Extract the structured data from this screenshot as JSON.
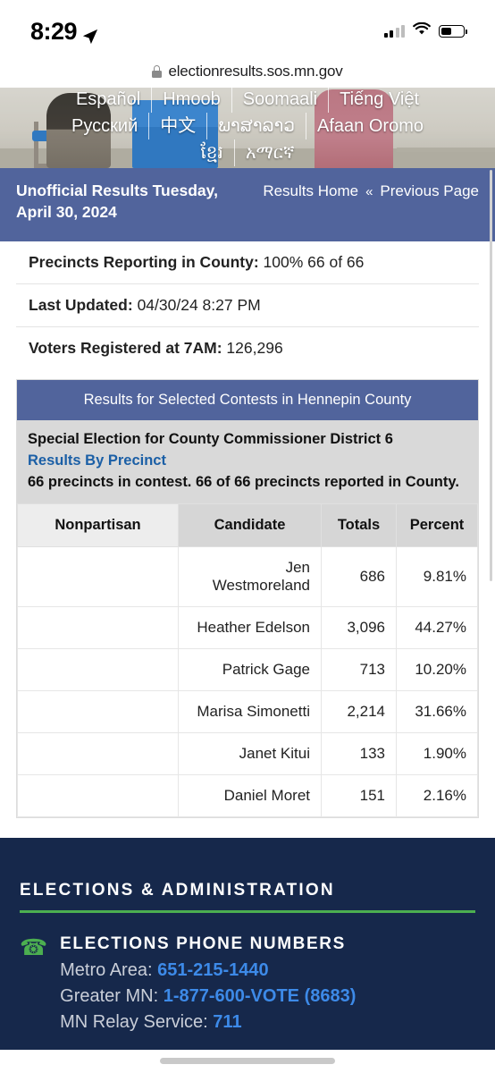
{
  "status_bar": {
    "time": "8:29",
    "location_icon": "location-arrow-icon",
    "signal_icon": "cellular-signal-icon",
    "wifi_icon": "wifi-icon",
    "battery_icon": "battery-icon"
  },
  "browser": {
    "lock_icon": "lock-icon",
    "url": "electionresults.sos.mn.gov"
  },
  "banner": {
    "languages_row1": [
      "Español",
      "Hmoob",
      "Soomaali",
      "Tiếng Việt"
    ],
    "languages_row2": [
      "Русский",
      "中文",
      "ພາສາລາວ",
      "Afaan Oromo"
    ],
    "languages_row3": [
      "ខ្មែរ",
      "አማርኛ"
    ]
  },
  "results_header": {
    "title": "Unofficial Results Tuesday, April 30, 2024",
    "results_home": "Results Home",
    "chevron": "«",
    "previous_page": "Previous Page"
  },
  "info": {
    "precincts_label": "Precincts Reporting in County:",
    "precincts_value": "100%  66 of 66",
    "updated_label": "Last Updated:",
    "updated_value": "04/30/24 8:27 PM",
    "registered_label": "Voters Registered at 7AM:",
    "registered_value": "126,296"
  },
  "contest": {
    "card_title": "Results for Selected Contests in Hennepin County",
    "name": "Special Election for County Commissioner District 6",
    "precinct_link": "Results By Precinct",
    "precinct_note": "66 precincts in contest. 66 of 66 precincts reported in County.",
    "columns": [
      "Nonpartisan",
      "Candidate",
      "Totals",
      "Percent"
    ],
    "rows": [
      {
        "party": "",
        "candidate": "Jen Westmoreland",
        "total": "686",
        "percent": "9.81%"
      },
      {
        "party": "",
        "candidate": "Heather Edelson",
        "total": "3,096",
        "percent": "44.27%"
      },
      {
        "party": "",
        "candidate": "Patrick Gage",
        "total": "713",
        "percent": "10.20%"
      },
      {
        "party": "",
        "candidate": "Marisa Simonetti",
        "total": "2,214",
        "percent": "31.66%"
      },
      {
        "party": "",
        "candidate": "Janet Kitui",
        "total": "133",
        "percent": "1.90%"
      },
      {
        "party": "",
        "candidate": "Daniel Moret",
        "total": "151",
        "percent": "2.16%"
      }
    ]
  },
  "footer": {
    "section_title": "ELECTIONS & ADMINISTRATION",
    "phone_icon": "phone-icon",
    "phone_heading": "ELECTIONS PHONE NUMBERS",
    "metro_label": "Metro Area: ",
    "metro_number": "651-215-1440",
    "greater_label": "Greater MN: ",
    "greater_number": "1-877-600-VOTE (8683)",
    "relay_label": "MN Relay Service: ",
    "relay_number": "711"
  },
  "colors": {
    "header_blue": "#51649c",
    "footer_navy": "#16284b",
    "accent_green": "#4caf50",
    "link_blue": "#3d8ae8",
    "contest_link_blue": "#1b5fa6"
  }
}
